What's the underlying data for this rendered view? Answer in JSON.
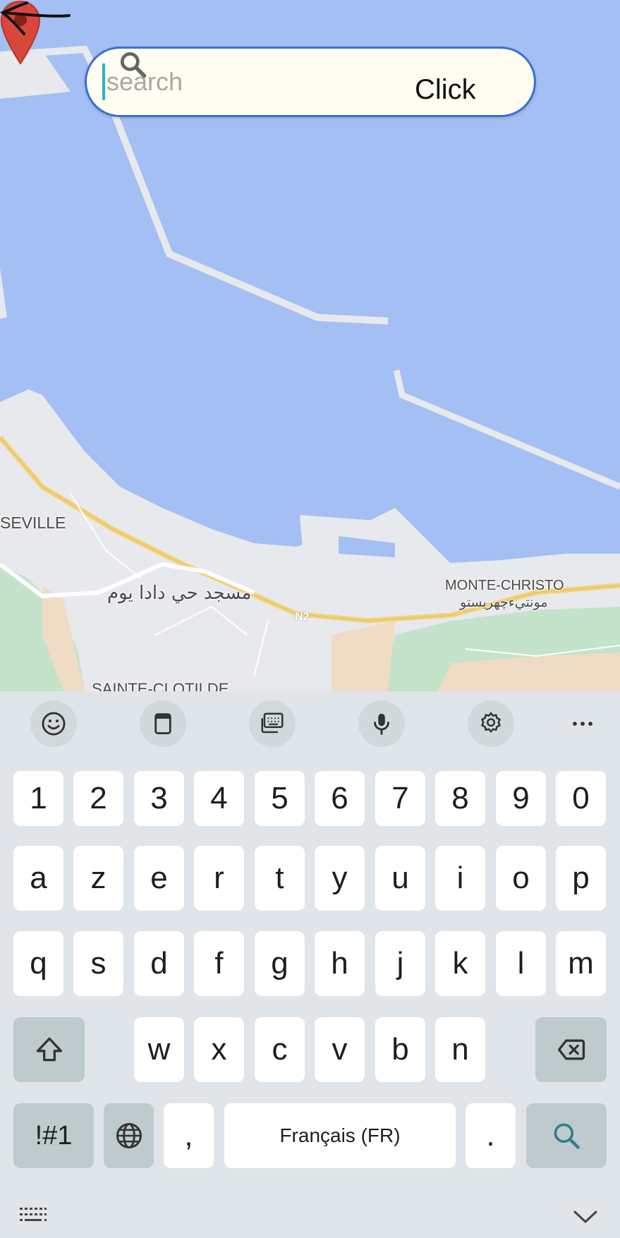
{
  "map": {
    "labels": {
      "seville": "SEVILLE",
      "mosque": "مسجد حي دادا يوم",
      "monte_christo": "MONTE-CHRISTO",
      "monte_christo_ar": "مونتيءچهريستو",
      "sainte_clotilde": "SAINTE-CLOTILDE",
      "road": "N2"
    },
    "colors": {
      "water": "#a4bff3",
      "land": "#e8e9ec",
      "road": "#f2d27a",
      "green": "#c4e3cb",
      "sand": "#f0dcc4",
      "pin": "#d9473b"
    }
  },
  "search": {
    "placeholder": "search",
    "value": ""
  },
  "annotation": {
    "text": "Click"
  },
  "keyboard": {
    "toolbar": [
      "emoji-icon",
      "clipboard-icon",
      "keyboard-layout-icon",
      "microphone-icon",
      "settings-icon",
      "more-icon"
    ],
    "rows": {
      "numbers": [
        "1",
        "2",
        "3",
        "4",
        "5",
        "6",
        "7",
        "8",
        "9",
        "0"
      ],
      "row1": [
        "a",
        "z",
        "e",
        "r",
        "t",
        "y",
        "u",
        "i",
        "o",
        "p"
      ],
      "row2": [
        "q",
        "s",
        "d",
        "f",
        "g",
        "h",
        "j",
        "k",
        "l",
        "m"
      ],
      "row3": [
        "w",
        "x",
        "c",
        "v",
        "b",
        "n"
      ]
    },
    "symbols_label": "!#1",
    "comma": ",",
    "space_label": "Français (FR)",
    "period": ".",
    "colors": {
      "key": "#ffffff",
      "special_key": "#bfcacd",
      "background": "#dfe5e8",
      "accent": "#2f7f8e"
    }
  }
}
